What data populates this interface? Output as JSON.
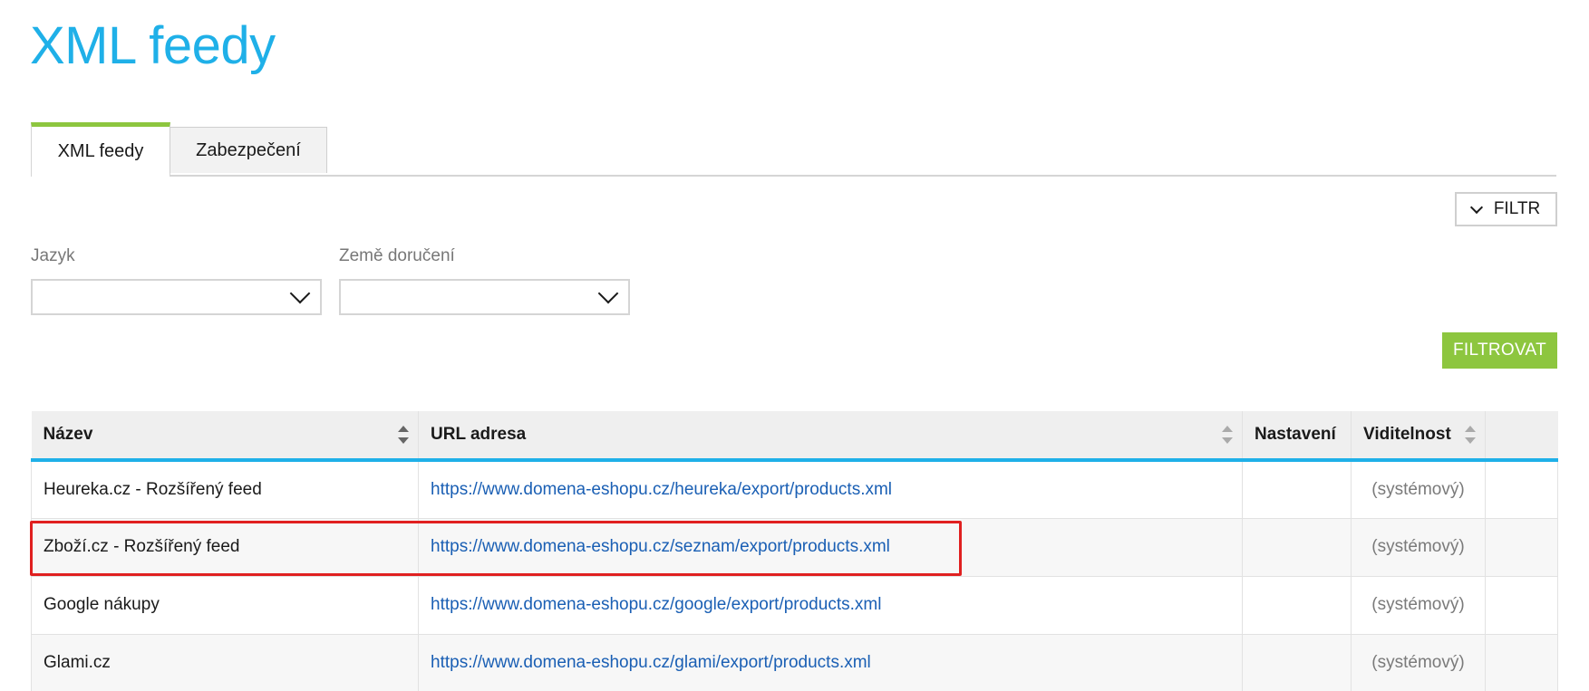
{
  "page": {
    "title": "XML feedy"
  },
  "tabs": [
    {
      "label": "XML feedy",
      "active": true
    },
    {
      "label": "Zabezpečení",
      "active": false
    }
  ],
  "filter": {
    "toggle_label": "FILTR",
    "language_label": "Jazyk",
    "language_value": "",
    "country_label": "Země doručení",
    "country_value": "",
    "submit_label": "FILTROVAT"
  },
  "table": {
    "columns": [
      "Název",
      "URL adresa",
      "Nastavení",
      "Viditelnost",
      ""
    ],
    "rows": [
      {
        "name": "Heureka.cz - Rozšířený feed",
        "url": "https://www.domena-eshopu.cz/heureka/export/products.xml",
        "settings": "",
        "visibility": "(systémový)"
      },
      {
        "name": "Zboží.cz - Rozšířený feed",
        "url": "https://www.domena-eshopu.cz/seznam/export/products.xml",
        "settings": "",
        "visibility": "(systémový)"
      },
      {
        "name": "Google nákupy",
        "url": "https://www.domena-eshopu.cz/google/export/products.xml",
        "settings": "",
        "visibility": "(systémový)"
      },
      {
        "name": "Glami.cz",
        "url": "https://www.domena-eshopu.cz/glami/export/products.xml",
        "settings": "",
        "visibility": "(systémový)"
      }
    ]
  },
  "colors": {
    "title": "#1fb0e8",
    "accent_green": "#8dc63f",
    "header_underline": "#1fb0e8",
    "link": "#1a5fb4",
    "highlight": "#e02020"
  },
  "icons": {
    "filter_toggle": "chevron-down-icon",
    "select_arrow": "chevron-down-icon",
    "sort": "sort-icon"
  }
}
